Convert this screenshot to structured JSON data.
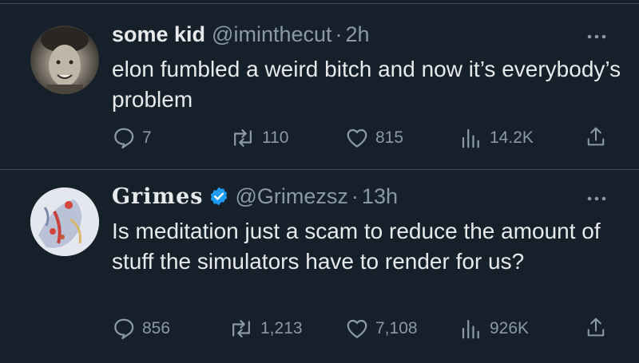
{
  "tweets": [
    {
      "display_name": "some kid",
      "handle": "@iminthecut",
      "separator": "·",
      "time": "2h",
      "text": "elon fumbled a weird bitch and now it’s everybody’s problem",
      "verified": false,
      "stats": {
        "replies": "7",
        "reposts": "110",
        "likes": "815",
        "views": "14.2K"
      }
    },
    {
      "display_name": "Grimes",
      "handle": "@Grimezsz",
      "separator": "·",
      "time": "13h",
      "text": "Is meditation just a scam to reduce the amount of stuff the simulators have to render for us?",
      "verified": true,
      "stats": {
        "replies": "856",
        "reposts": "1,213",
        "likes": "7,108",
        "views": "926K"
      }
    }
  ],
  "icons": {
    "reply": "reply-icon",
    "repost": "repost-icon",
    "like": "heart-icon",
    "views": "views-bar-chart-icon",
    "share": "share-icon",
    "more": "more-options-icon",
    "verified": "verified-badge-icon"
  },
  "colors": {
    "background": "#15202b",
    "text_primary": "#e7e9ea",
    "text_secondary": "#8b98a5",
    "divider": "#38444d",
    "verified_blue": "#1d9bf0"
  }
}
